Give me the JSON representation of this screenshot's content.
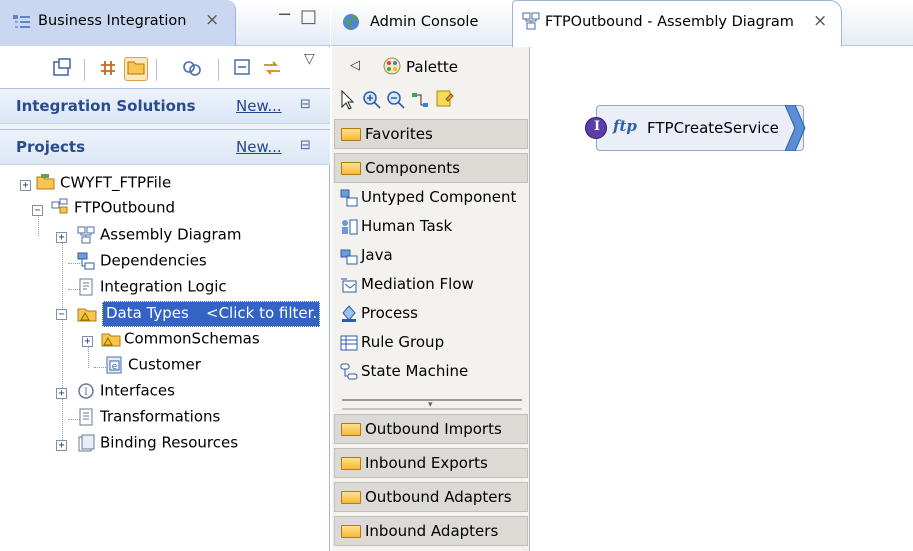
{
  "left_view": {
    "tab_title": "Business Integration",
    "tab_close": "×",
    "toolbar_icons": [
      "open-type-icon",
      "show-references-icon",
      "open-folder-icon",
      "link-icon",
      "collapse-all-icon",
      "link-with-editor-icon"
    ],
    "view_menu": "▽",
    "minimize": "−",
    "maximize": "□",
    "integration_solutions": {
      "title": "Integration Solutions",
      "new_link": "New...",
      "min": "⊟"
    },
    "projects": {
      "title": "Projects",
      "new_link": "New...",
      "min": "⊟"
    },
    "tree": [
      {
        "label": "CWYFT_FTPFile",
        "icon": "project-icon"
      },
      {
        "label": "FTPOutbound",
        "icon": "module-icon"
      },
      {
        "label": "Assembly Diagram",
        "icon": "assembly-diagram-icon"
      },
      {
        "label": "Dependencies",
        "icon": "dependencies-icon"
      },
      {
        "label": "Integration Logic",
        "icon": "integration-logic-icon"
      },
      {
        "label": "Data Types",
        "icon": "data-types-warning-icon",
        "filter_hint": "<Click to filter."
      },
      {
        "label": "CommonSchemas",
        "icon": "folder-warning-icon"
      },
      {
        "label": "Customer",
        "icon": "business-object-icon"
      },
      {
        "label": "Interfaces",
        "icon": "interface-icon"
      },
      {
        "label": "Transformations",
        "icon": "transformations-icon"
      },
      {
        "label": "Binding Resources",
        "icon": "binding-resources-icon"
      }
    ]
  },
  "editor": {
    "tabs": [
      {
        "label": "Admin Console",
        "icon": "globe-icon"
      },
      {
        "label": "FTPOutbound - Assembly Diagram",
        "icon": "assembly-diagram-icon",
        "close": "×"
      }
    ],
    "palette": {
      "title": "Palette",
      "collapse_arrow": "◁",
      "tools": [
        "select-arrow-icon",
        "zoom-in-icon",
        "zoom-out-icon",
        "wire-icon",
        "note-icon"
      ],
      "drawers_top": [
        "Favorites",
        "Components"
      ],
      "component_items": [
        {
          "label": "Untyped Component",
          "icon": "untyped-component-icon"
        },
        {
          "label": "Human Task",
          "icon": "human-task-icon"
        },
        {
          "label": "Java",
          "icon": "java-icon"
        },
        {
          "label": "Mediation Flow",
          "icon": "mediation-flow-icon"
        },
        {
          "label": "Process",
          "icon": "process-icon"
        },
        {
          "label": "Rule Group",
          "icon": "rule-group-icon"
        },
        {
          "label": "State Machine",
          "icon": "state-machine-icon"
        }
      ],
      "drawers_bottom": [
        "Outbound Imports",
        "Inbound Exports",
        "Outbound Adapters",
        "Inbound Adapters"
      ]
    },
    "canvas": {
      "component": {
        "label": "FTPCreateService",
        "interface_badge": "I",
        "ftp_badge": "ftp"
      }
    }
  },
  "colors": {
    "selection": "#3463c6",
    "header_text": "#2a4b8d",
    "link": "#22458f",
    "palette_bg": "#f3f2ef"
  }
}
